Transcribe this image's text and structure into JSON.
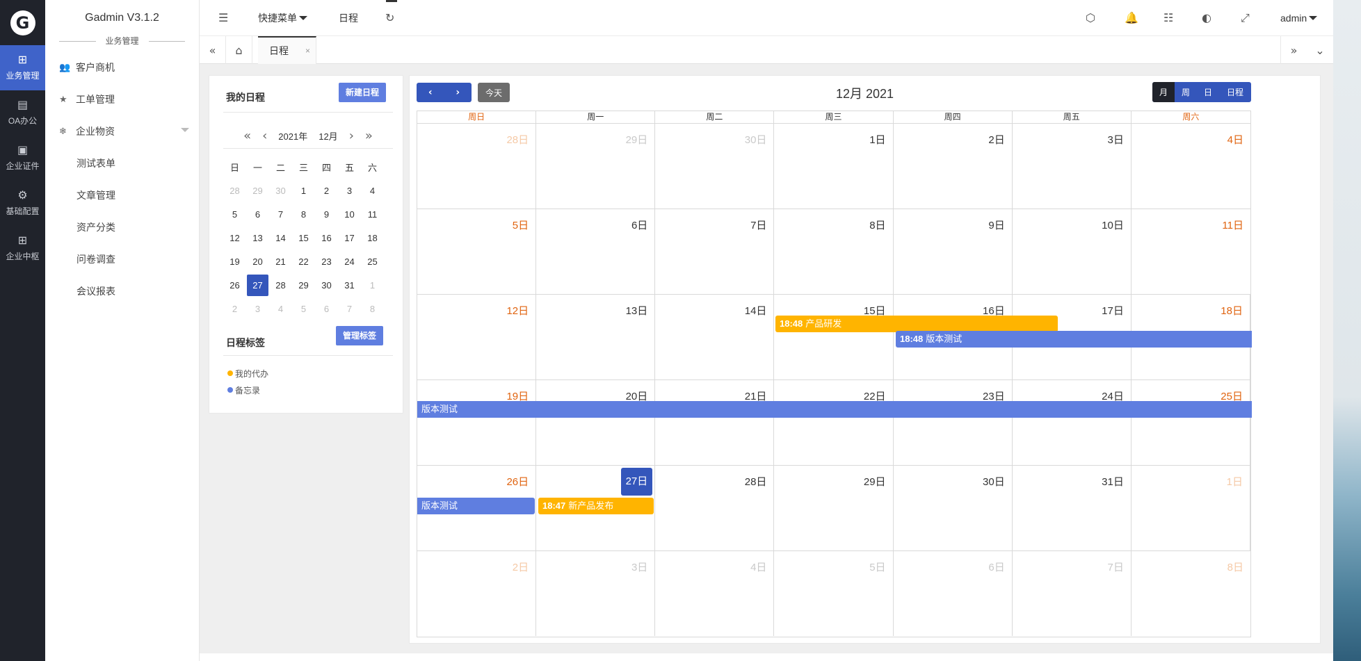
{
  "app": {
    "title": "Gadmin V3.1.2"
  },
  "rail": {
    "items": [
      {
        "label": "业务管理",
        "icon": "grid-icon"
      },
      {
        "label": "OA办公",
        "icon": "doc-icon"
      },
      {
        "label": "企业证件",
        "icon": "id-card-icon"
      },
      {
        "label": "基础配置",
        "icon": "gear-icon"
      },
      {
        "label": "企业中枢",
        "icon": "apps-icon"
      }
    ]
  },
  "menu": {
    "section": "业务管理",
    "items": [
      {
        "label": "客户商机",
        "icon": "users-icon"
      },
      {
        "label": "工单管理",
        "icon": "star-icon"
      },
      {
        "label": "企业物资",
        "icon": "snowflake-icon"
      }
    ],
    "subitems": [
      "测试表单",
      "文章管理",
      "资产分类",
      "问卷调查",
      "会议报表"
    ]
  },
  "topbar": {
    "quick_menu": "快捷菜单",
    "schedule": "日程",
    "user": "admin"
  },
  "tabs": {
    "active": "日程",
    "close": "×"
  },
  "left_panel": {
    "title": "我的日程",
    "new_button": "新建日程",
    "mini_year": "2021年",
    "mini_month": "12月",
    "weekdays": [
      "日",
      "一",
      "二",
      "三",
      "四",
      "五",
      "六"
    ],
    "weeks": [
      [
        "28",
        "29",
        "30",
        "1",
        "2",
        "3",
        "4"
      ],
      [
        "5",
        "6",
        "7",
        "8",
        "9",
        "10",
        "11"
      ],
      [
        "12",
        "13",
        "14",
        "15",
        "16",
        "17",
        "18"
      ],
      [
        "19",
        "20",
        "21",
        "22",
        "23",
        "24",
        "25"
      ],
      [
        "26",
        "27",
        "28",
        "29",
        "30",
        "31",
        "1"
      ],
      [
        "2",
        "3",
        "4",
        "5",
        "6",
        "7",
        "8"
      ]
    ],
    "tags_title": "日程标签",
    "manage_button": "管理标签",
    "tags": [
      {
        "label": "我的代办",
        "color": "#ffb400"
      },
      {
        "label": "备忘录",
        "color": "#5f7ee0"
      }
    ]
  },
  "calendar": {
    "title": "12月 2021",
    "today_button": "今天",
    "views": [
      "月",
      "周",
      "日",
      "日程"
    ],
    "active_view": "月",
    "day_headers": [
      "周日",
      "周一",
      "周二",
      "周三",
      "周四",
      "周五",
      "周六"
    ],
    "weeks": [
      [
        "28日",
        "29日",
        "30日",
        "1日",
        "2日",
        "3日",
        "4日"
      ],
      [
        "5日",
        "6日",
        "7日",
        "8日",
        "9日",
        "10日",
        "11日"
      ],
      [
        "12日",
        "13日",
        "14日",
        "15日",
        "16日",
        "17日",
        "18日"
      ],
      [
        "19日",
        "20日",
        "21日",
        "22日",
        "23日",
        "24日",
        "25日"
      ],
      [
        "26日",
        "27日",
        "28日",
        "29日",
        "30日",
        "31日",
        "1日"
      ],
      [
        "2日",
        "3日",
        "4日",
        "5日",
        "6日",
        "7日",
        "8日"
      ]
    ],
    "events": [
      {
        "time": "18:48",
        "title": "产品研发",
        "color": "#ffb400"
      },
      {
        "time": "18:48",
        "title": "版本测试",
        "color": "#5f7ee0"
      },
      {
        "time": "",
        "title": "版本测试",
        "color": "#5f7ee0"
      },
      {
        "time": "",
        "title": "版本测试",
        "color": "#5f7ee0"
      },
      {
        "time": "18:47",
        "title": "新产品发布",
        "color": "#ffb400"
      }
    ]
  }
}
